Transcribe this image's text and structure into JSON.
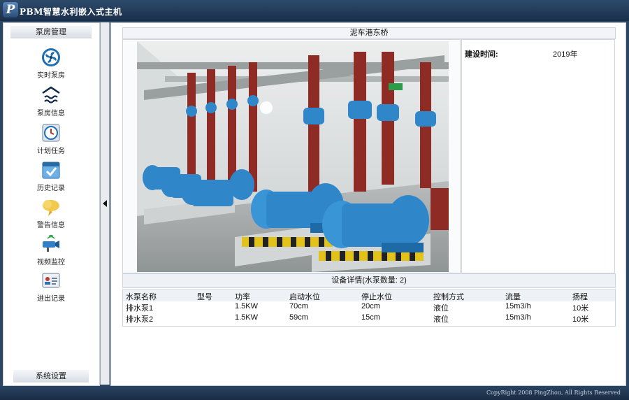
{
  "app": {
    "logo_letter": "P",
    "title": "PBM智慧水利嵌入式主机"
  },
  "sidebar": {
    "header": "泵房管理",
    "items": [
      {
        "label": "实时泵房",
        "icon": "pump-fan-icon"
      },
      {
        "label": "泵房信息",
        "icon": "heat-waves-icon"
      },
      {
        "label": "计划任务",
        "icon": "clock-icon"
      },
      {
        "label": "历史记录",
        "icon": "checklist-icon"
      },
      {
        "label": "警告信息",
        "icon": "warning-cloud-icon"
      },
      {
        "label": "视频监控",
        "icon": "camera-icon"
      },
      {
        "label": "进出记录",
        "icon": "id-card-icon"
      }
    ],
    "footer": "系统设置"
  },
  "station": {
    "name": "泥车港东桥",
    "build_time_label": "建设时间:",
    "build_time_value": "2019年"
  },
  "details": {
    "title": "设备详情(水泵数量: 2)",
    "columns": [
      "水泵名称",
      "型号",
      "功率",
      "启动水位",
      "停止水位",
      "控制方式",
      "流量",
      "扬程"
    ],
    "rows": [
      [
        "排水泵1",
        "",
        "1.5KW",
        "70cm",
        "20cm",
        "液位",
        "15m3/h",
        "10米"
      ],
      [
        "排水泵2",
        "",
        "1.5KW",
        "59cm",
        "15cm",
        "液位",
        "15m3/h",
        "10米"
      ]
    ]
  },
  "footer": {
    "copyright": "CopyRight 2008 PingZhou, All Rights Reserved"
  },
  "colors": {
    "titlebar": "#1a2f4a",
    "pump_blue": "#2f86c8",
    "pipe_red": "#8e2b25"
  }
}
